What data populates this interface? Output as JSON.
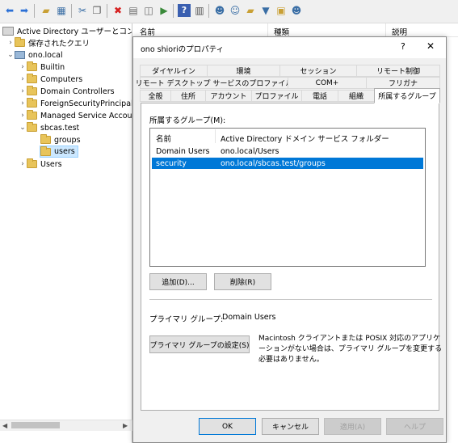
{
  "toolbar": {
    "icons": [
      "back-icon",
      "forward-icon",
      "up-folder-icon",
      "details-view-icon",
      "cut-icon",
      "copy-icon",
      "delete-icon",
      "properties-icon",
      "refresh-icon",
      "export-icon",
      "help-icon",
      "console-tree-icon",
      "new-user-icon",
      "new-group-icon",
      "new-ou-icon",
      "filter-icon",
      "find-icon",
      "add-to-group-icon"
    ]
  },
  "tree": {
    "root_label": "Active Directory ユーザーとコンピュータ",
    "saved_queries": "保存されたクエリ",
    "domain": "ono.local",
    "children": [
      "Builtin",
      "Computers",
      "Domain Controllers",
      "ForeignSecurityPrincipals",
      "Managed Service Accounts"
    ],
    "ou": "sbcas.test",
    "ou_children": [
      "groups",
      "users"
    ],
    "users": "Users"
  },
  "list_header": {
    "name": "名前",
    "type": "種類",
    "description": "説明"
  },
  "dialog": {
    "title": "ono shioriのプロパティ",
    "help": "?",
    "close": "✕",
    "tabs_row1": [
      "ダイヤルイン",
      "環境",
      "セッション",
      "リモート制御"
    ],
    "tabs_row2": [
      "リモート デスクトップ サービスのプロファイル",
      "COM+",
      "フリガナ"
    ],
    "tabs_row3": [
      "全般",
      "住所",
      "アカウント",
      "プロファイル",
      "電話",
      "組織",
      "所属するグループ"
    ],
    "member_of_label": "所属するグループ(M):",
    "columns": [
      "名前",
      "Active Directory ドメイン サービス フォルダー"
    ],
    "rows": [
      {
        "name": "Domain Users",
        "folder": "ono.local/Users",
        "selected": false
      },
      {
        "name": "security",
        "folder": "ono.local/sbcas.test/groups",
        "selected": true
      }
    ],
    "add_button": "追加(D)...",
    "remove_button": "削除(R)",
    "primary_group_label": "プライマリ グループ:",
    "primary_group_value": "Domain Users",
    "set_primary_button": "プライマリ グループの設定(S)",
    "note_line1": "Macintosh クライアントまたは POSIX 対応のアプリケ",
    "note_line2": "ーションがない場合は、プライマリ グループを変更する",
    "note_line3": "必要はありません。",
    "ok": "OK",
    "cancel": "キャンセル",
    "apply": "適用(A)",
    "helpbtn": "ヘルプ"
  },
  "colors": {
    "selection": "#0078d7",
    "tree_selection": "#cce8ff",
    "folder": "#e8c45a"
  }
}
